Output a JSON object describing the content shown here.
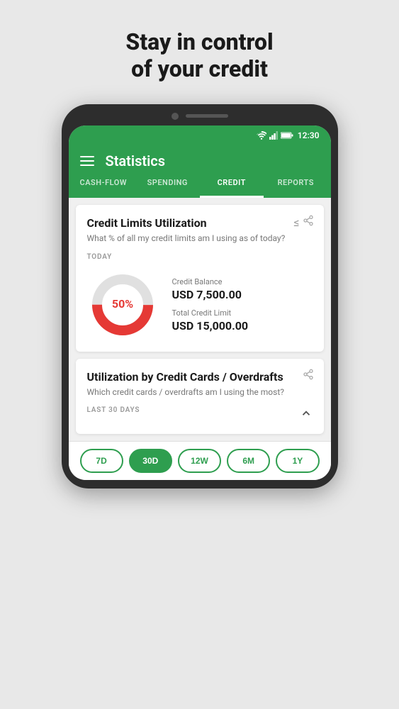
{
  "page": {
    "headline_line1": "Stay in control",
    "headline_line2": "of your credit"
  },
  "status_bar": {
    "time": "12:30"
  },
  "header": {
    "title": "Statistics"
  },
  "nav_tabs": [
    {
      "label": "CASH-FLOW",
      "active": false
    },
    {
      "label": "SPENDING",
      "active": false
    },
    {
      "label": "CREDIT",
      "active": true
    },
    {
      "label": "REPORTS",
      "active": false
    }
  ],
  "card1": {
    "title": "Credit Limits Utilization",
    "subtitle": "What % of all my credit limits am I using as of today?",
    "section_label": "TODAY",
    "donut_percent": 50,
    "donut_label": "50%",
    "credit_balance_label": "Credit Balance",
    "credit_balance_value": "USD 7,500.00",
    "total_limit_label": "Total Credit Limit",
    "total_limit_value": "USD 15,000.00"
  },
  "card2": {
    "title": "Utilization by Credit Cards / Overdrafts",
    "subtitle": "Which credit cards / overdrafts am I using the most?",
    "section_label": "LAST 30 DAYS"
  },
  "time_buttons": [
    {
      "label": "7D",
      "active": false
    },
    {
      "label": "30D",
      "active": true
    },
    {
      "label": "12W",
      "active": false
    },
    {
      "label": "6M",
      "active": false
    },
    {
      "label": "1Y",
      "active": false
    }
  ]
}
